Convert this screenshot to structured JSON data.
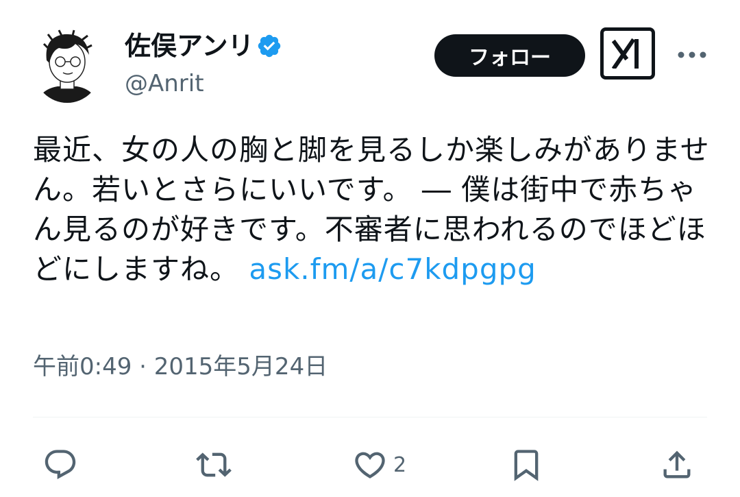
{
  "user": {
    "display_name": "佐俣アンリ",
    "handle": "@Anrit",
    "verified_icon": "verified-badge-icon",
    "avatar_icon": "avatar-illustration"
  },
  "header": {
    "follow_label": "フォロー",
    "grok_icon": "grok-icon",
    "more_icon": "more-dots-icon"
  },
  "tweet": {
    "text": "最近、女の人の胸と脚を見るしか楽しみがありません。若いとさらにいいです。 ― 僕は街中で赤ちゃん見るのが好きです。不審者に思われるのでほどほどにしますね。 ",
    "link_text": "ask.fm/a/c7kdpgpg",
    "timestamp": "午前0:49 · 2015年5月24日"
  },
  "actions": {
    "reply_icon": "reply-icon",
    "retweet_icon": "retweet-icon",
    "like_icon": "heart-icon",
    "like_count": "2",
    "bookmark_icon": "bookmark-icon",
    "share_icon": "share-icon"
  },
  "colors": {
    "text": "#0f1419",
    "secondary": "#536471",
    "link": "#1d9bf0",
    "verified": "#1d9bf0"
  }
}
